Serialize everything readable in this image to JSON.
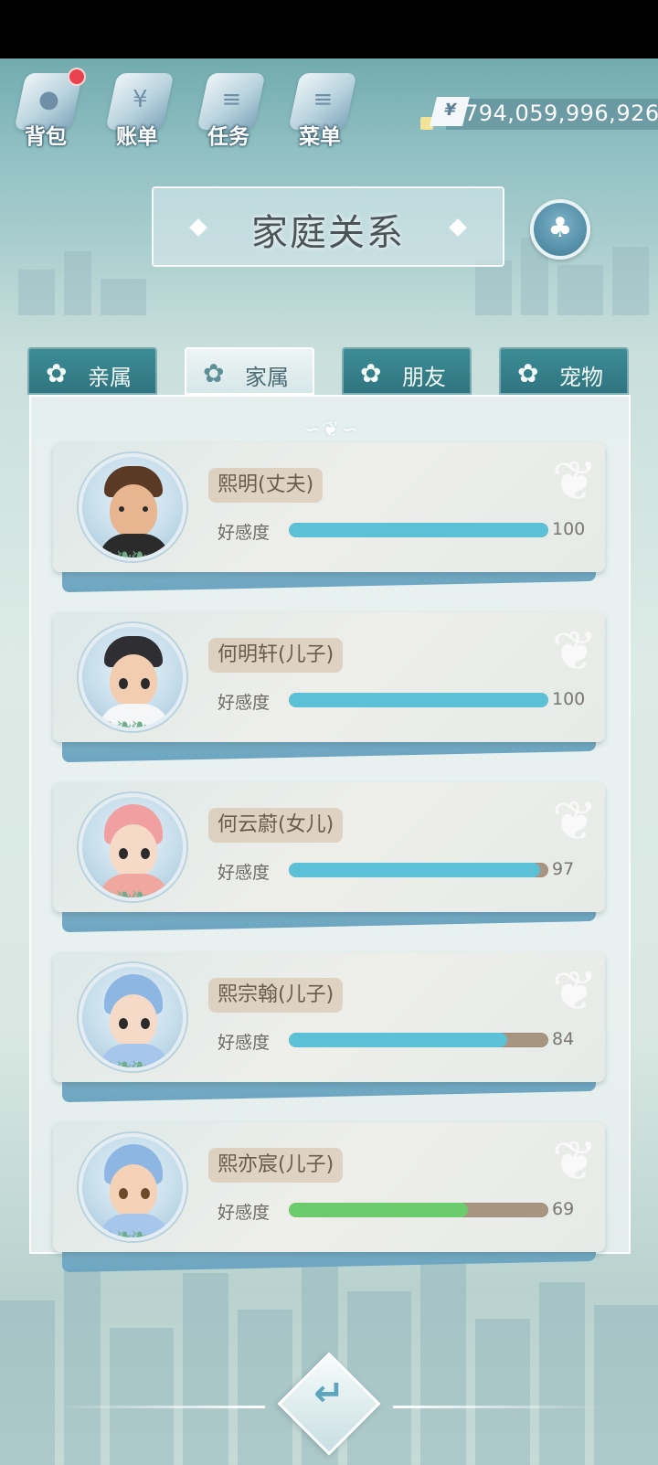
{
  "hud": {
    "items": [
      {
        "label": "背包",
        "icon": "bag-icon",
        "glyph": "●",
        "badge": true
      },
      {
        "label": "账单",
        "icon": "bill-icon",
        "glyph": "¥",
        "badge": false
      },
      {
        "label": "任务",
        "icon": "task-icon",
        "glyph": "≡",
        "badge": false
      },
      {
        "label": "菜单",
        "icon": "menu-icon",
        "glyph": "≡",
        "badge": false
      }
    ],
    "currency_symbol": "¥",
    "money": "794,059,996,926"
  },
  "title": "家庭关系",
  "tree_icon": "family-tree-icon",
  "tabs": [
    {
      "label": "亲属",
      "active": false
    },
    {
      "label": "家属",
      "active": true
    },
    {
      "label": "朋友",
      "active": false
    },
    {
      "label": "宠物",
      "active": false
    }
  ],
  "favor_label": "好感度",
  "members": [
    {
      "name": "熙明(丈夫)",
      "favor": 100,
      "favor_text": "100",
      "bar_color": "#5cc1d6",
      "avatar": "man-avatar"
    },
    {
      "name": "何明轩(儿子)",
      "favor": 100,
      "favor_text": "100",
      "bar_color": "#5cc1d6",
      "avatar": "boy-cap-avatar"
    },
    {
      "name": "何云蔚(女儿)",
      "favor": 97,
      "favor_text": "97",
      "bar_color": "#5cc1d6",
      "avatar": "baby-pink-avatar"
    },
    {
      "name": "熙宗翰(儿子)",
      "favor": 84,
      "favor_text": "84",
      "bar_color": "#5cc1d6",
      "avatar": "baby-blue-avatar"
    },
    {
      "name": "熙亦宸(儿子)",
      "favor": 69,
      "favor_text": "69",
      "bar_color": "#6ccb6d",
      "avatar": "baby-blue-avatar"
    }
  ],
  "back_icon": "back-arrow-icon"
}
